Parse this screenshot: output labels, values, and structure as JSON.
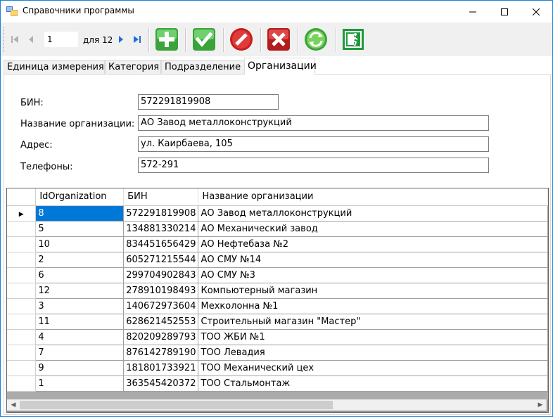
{
  "window": {
    "title": "Справочники программы",
    "minimize": "—",
    "maximize": "☐",
    "close": "✕"
  },
  "toolbar": {
    "position": "1",
    "of_text": "для 12",
    "buttons": [
      "add-icon",
      "save-icon",
      "cancel-icon",
      "delete-icon",
      "refresh-icon",
      "exit-icon"
    ]
  },
  "tabs": [
    "Единица измерения",
    "Категория",
    "Подразделение",
    "Организации"
  ],
  "active_tab": "Организации",
  "form": {
    "bin_label": "БИН:",
    "bin_value": "572291819908",
    "name_label": "Название организации:",
    "name_value": "АО Завод металлоконструкций",
    "address_label": "Адрес:",
    "address_value": "ул. Каирбаева, 105",
    "phones_label": "Телефоны:",
    "phones_value": "572-291"
  },
  "grid": {
    "columns": [
      "IdOrganization",
      "БИН",
      "Название организации"
    ],
    "rows": [
      [
        "8",
        "572291819908",
        "АО Завод металлоконструкций"
      ],
      [
        "5",
        "134881330214",
        "АО Механический завод"
      ],
      [
        "10",
        "834451656429",
        "АО Нефтебаза №2"
      ],
      [
        "2",
        "605271215544",
        "АО СМУ №14"
      ],
      [
        "6",
        "299704902843",
        "АО СМУ №3"
      ],
      [
        "12",
        "278910198493",
        "Компьютерный магазин"
      ],
      [
        "3",
        "140672973604",
        "Мехколонна №1"
      ],
      [
        "11",
        "628621452553",
        "Строительный магазин \"Мастер\""
      ],
      [
        "4",
        "820209289793",
        "ТОО ЖБИ №1"
      ],
      [
        "7",
        "876142789190",
        "ТОО Левадия"
      ],
      [
        "9",
        "181801733921",
        "ТОО Механический цех"
      ],
      [
        "1",
        "363545420372",
        "ТОО Стальмонтаж"
      ]
    ],
    "selected_row": 0,
    "row_indicator": "▶"
  }
}
